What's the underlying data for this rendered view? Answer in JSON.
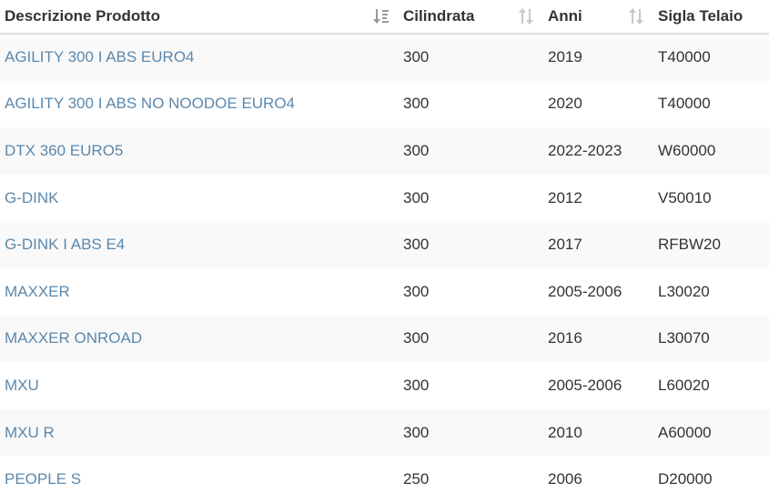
{
  "table": {
    "headers": [
      {
        "label": "Descrizione Prodotto",
        "sort": "sort-desc-icon"
      },
      {
        "label": "Cilindrata",
        "sort": "sort-icon"
      },
      {
        "label": "Anni",
        "sort": "sort-icon"
      },
      {
        "label": "Sigla Telaio",
        "sort": "none"
      }
    ],
    "rows": [
      {
        "name": "AGILITY 300 I ABS EURO4",
        "cc": "300",
        "years": "2019",
        "frame": "T40000"
      },
      {
        "name": "AGILITY 300 I ABS NO NOODOE EURO4",
        "cc": "300",
        "years": "2020",
        "frame": "T40000"
      },
      {
        "name": "DTX 360 EURO5",
        "cc": "300",
        "years": "2022-2023",
        "frame": "W60000"
      },
      {
        "name": "G-DINK",
        "cc": "300",
        "years": "2012",
        "frame": "V50010"
      },
      {
        "name": "G-DINK I ABS E4",
        "cc": "300",
        "years": "2017",
        "frame": "RFBW20"
      },
      {
        "name": "MAXXER",
        "cc": "300",
        "years": "2005-2006",
        "frame": "L30020"
      },
      {
        "name": "MAXXER ONROAD",
        "cc": "300",
        "years": "2016",
        "frame": "L30070"
      },
      {
        "name": "MXU",
        "cc": "300",
        "years": "2005-2006",
        "frame": "L60020"
      },
      {
        "name": "MXU R",
        "cc": "300",
        "years": "2010",
        "frame": "A60000"
      },
      {
        "name": "PEOPLE S",
        "cc": "250",
        "years": "2006",
        "frame": "D20000"
      }
    ]
  },
  "colors": {
    "link": "#5b88ad",
    "text": "#333333",
    "stripe": "#f9f9f9",
    "sort_icon": "#bbbbbb"
  }
}
